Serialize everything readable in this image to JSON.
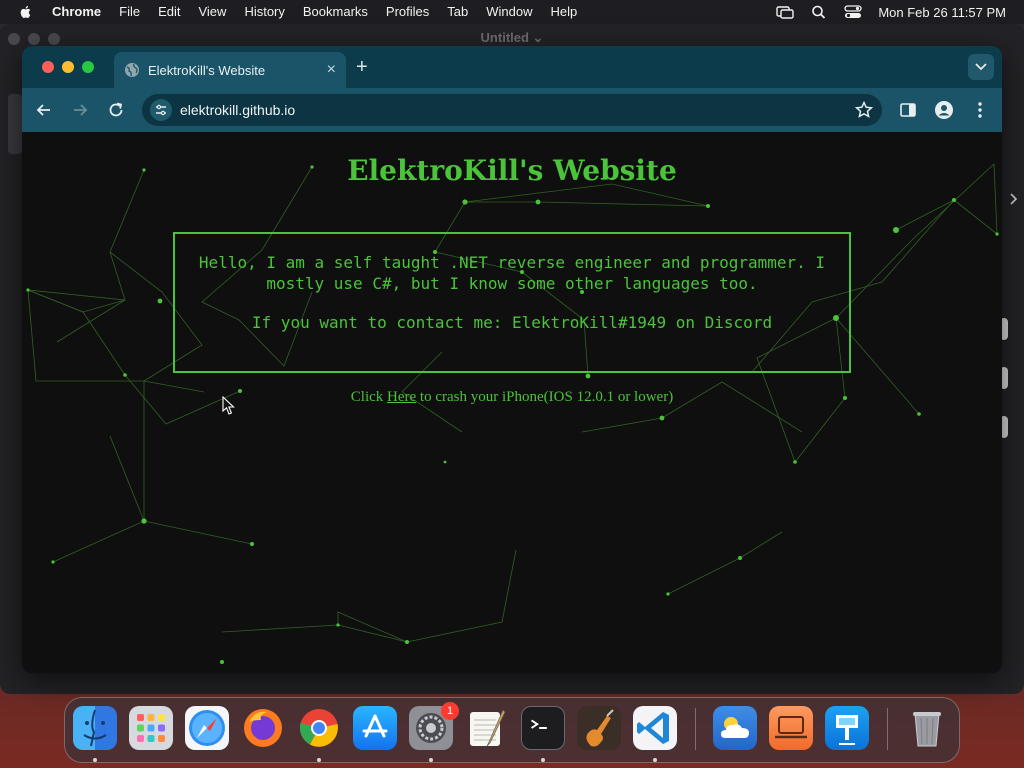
{
  "menubar": {
    "app_name": "Chrome",
    "items": [
      "File",
      "Edit",
      "View",
      "History",
      "Bookmarks",
      "Profiles",
      "Tab",
      "Window",
      "Help"
    ],
    "clock": "Mon Feb 26  11:57 PM"
  },
  "background_window": {
    "title": "Untitled ⌄"
  },
  "browser": {
    "tab_title": "ElektroKill's Website",
    "url": "elektrokill.github.io"
  },
  "page": {
    "title": "ElektroKill's Website",
    "intro": "Hello, I am a self taught .NET reverse engineer and programmer. I mostly use C#, but I know some other languages too.",
    "contact": "If you want to contact me: ElektroKill#1949 on Discord",
    "crash_prefix": "Click ",
    "crash_link": "Here",
    "crash_suffix": " to crash your iPhone(IOS 12.0.1 or lower)"
  },
  "dock": {
    "items": [
      "finder",
      "launchpad",
      "safari",
      "firefox",
      "chrome",
      "app-store",
      "system-settings",
      "textedit",
      "terminal",
      "garageband",
      "vscode",
      "weather",
      "screen-sharing",
      "keynote",
      "trash"
    ],
    "settings_badge": "1"
  },
  "colors": {
    "accent_green": "#4bc33a",
    "tab_bar": "#0c3b4c",
    "toolbar": "#1b5468"
  }
}
